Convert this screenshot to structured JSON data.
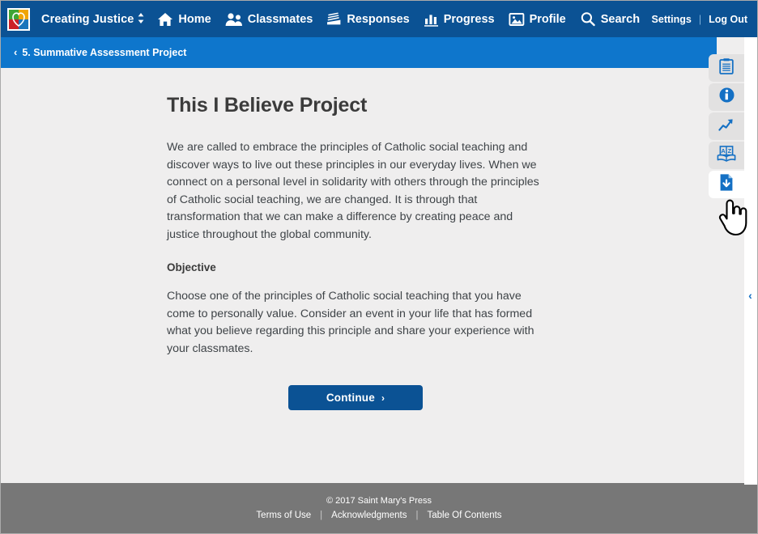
{
  "header": {
    "logo_name": "saint-marys-press-logo",
    "course_title": "Creating Justice",
    "course_switcher_icon": "up-down-caret-icon",
    "nav": [
      {
        "label": "Home",
        "icon": "home-icon"
      },
      {
        "label": "Classmates",
        "icon": "people-icon"
      },
      {
        "label": "Responses",
        "icon": "paper-stack-icon"
      },
      {
        "label": "Progress",
        "icon": "bar-chart-icon"
      },
      {
        "label": "Profile",
        "icon": "picture-icon"
      },
      {
        "label": "Search",
        "icon": "magnifier-icon"
      }
    ],
    "settings_label": "Settings",
    "separator": "|",
    "logout_label": "Log Out"
  },
  "subnav": {
    "back_icon": "chevron-left-icon",
    "breadcrumb": "5. Summative Assessment Project"
  },
  "main": {
    "title": "This I Believe Project",
    "intro_paragraph": "We are called to embrace the principles of Catholic social teaching and discover ways to live out these principles in our everyday lives. When we connect on a personal level in solidarity with others through the principles of Catholic social teaching, we are changed. It is through that transformation that we can make a difference by creating peace and justice throughout the global community.",
    "objective_heading": "Objective",
    "objective_paragraph": "Choose one of the principles of Catholic social teaching that you have come to personally value. Consider an event in your life that has formed what you believe regarding this principle and share your experience with your classmates.",
    "continue_label": "Continue",
    "continue_arrow": "›"
  },
  "rail": {
    "tabs": [
      {
        "name": "notes-tab",
        "icon": "clipboard-icon",
        "active": false
      },
      {
        "name": "info-tab",
        "icon": "info-circle-icon",
        "active": false
      },
      {
        "name": "progress-tab",
        "icon": "trend-arrow-icon",
        "active": false
      },
      {
        "name": "glossary-tab",
        "icon": "az-book-icon",
        "active": false
      },
      {
        "name": "download-tab",
        "icon": "document-download-icon",
        "active": true
      }
    ],
    "collapse_icon": "chevron-left-icon"
  },
  "cursor": {
    "icon": "pointing-hand-cursor"
  },
  "footer": {
    "copyright": "© 2017 Saint Mary's Press",
    "links": [
      "Terms of Use",
      "Acknowledgments",
      "Table Of Contents"
    ],
    "separator": "|"
  },
  "colors": {
    "header_blue": "#0b5294",
    "subnav_blue": "#0e76cc",
    "accent_blue": "#1470c4",
    "page_bg": "#efeeee",
    "footer_gray": "#777777",
    "text_dark": "#3b3b3b"
  }
}
